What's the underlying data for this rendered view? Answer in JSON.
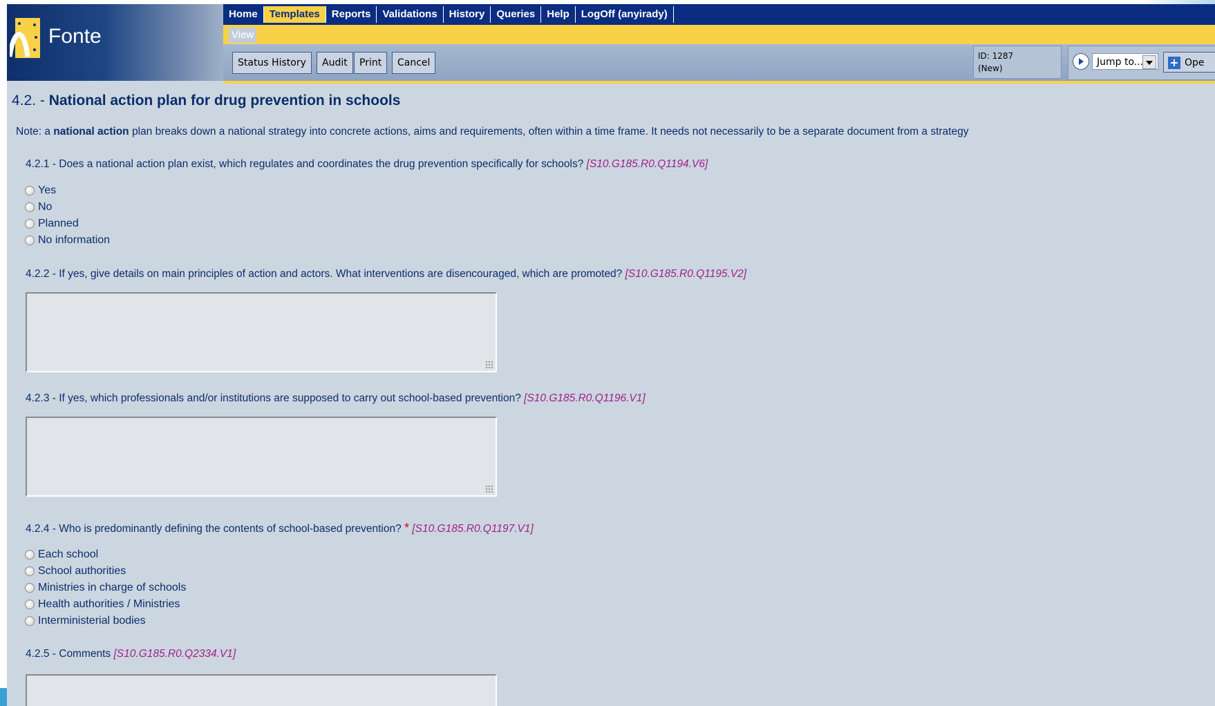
{
  "logo": {
    "text": "Fonte",
    "icon": "fonte-logo-icon"
  },
  "nav": {
    "items": [
      {
        "label": "Home",
        "active": false
      },
      {
        "label": "Templates",
        "active": true
      },
      {
        "label": "Reports",
        "active": false
      },
      {
        "label": "Validations",
        "active": false
      },
      {
        "label": "History",
        "active": false
      },
      {
        "label": "Queries",
        "active": false
      },
      {
        "label": "Help",
        "active": false
      },
      {
        "label": "LogOff (anyirady)",
        "active": false
      }
    ]
  },
  "subnav": {
    "view_label": "View"
  },
  "toolbar": {
    "status_history": "Status History",
    "audit": "Audit",
    "print": "Print",
    "cancel": "Cancel",
    "id_line1": "ID: 1287",
    "id_line2": "(New)",
    "jump_label": "Jump to...",
    "open_label": "Ope"
  },
  "section": {
    "number": "4.2. - ",
    "title": "National action plan for drug prevention in schools",
    "note_prefix": "Note: a ",
    "note_bold": "national action",
    "note_rest": " plan breaks down a national strategy into concrete actions, aims and requirements, often within a time frame. It needs not necessarily to be a separate document from a strategy"
  },
  "questions": {
    "q1": {
      "text": "4.2.1 - Does a national action plan exist, which regulates and coordinates the drug prevention specifically for schools? ",
      "code": "[S10.G185.R0.Q1194.V6]",
      "options": [
        "Yes",
        "No",
        "Planned",
        "No information"
      ]
    },
    "q2": {
      "text": "4.2.2 - If yes, give details on main principles of action and actors. What interventions are disencouraged, which are promoted? ",
      "code": "[S10.G185.R0.Q1195.V2]"
    },
    "q3": {
      "text": "4.2.3 - If yes, which professionals and/or institutions are supposed to carry out school-based prevention? ",
      "code": "[S10.G185.R0.Q1196.V1]"
    },
    "q4": {
      "text": "4.2.4 - Who is predominantly defining the contents of school-based prevention? ",
      "required": "*",
      "code": "[S10.G185.R0.Q1197.V1]",
      "options": [
        "Each school",
        "School authorities",
        "Ministries in charge of schools",
        "Health authorities / Ministries",
        "Interministerial bodies"
      ]
    },
    "q5": {
      "text": "4.2.5 - Comments ",
      "code": "[S10.G185.R0.Q2334.V1]"
    }
  },
  "colors": {
    "nav_bg": "#0a2d82",
    "accent_yellow": "#f8d146",
    "content_bg": "#ccd6e0",
    "code_color": "#a0208a"
  }
}
